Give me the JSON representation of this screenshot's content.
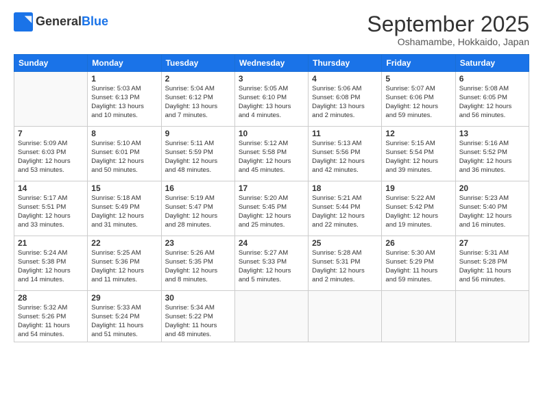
{
  "logo": {
    "general": "General",
    "blue": "Blue"
  },
  "header": {
    "month": "September 2025",
    "location": "Oshamambe, Hokkaido, Japan"
  },
  "weekdays": [
    "Sunday",
    "Monday",
    "Tuesday",
    "Wednesday",
    "Thursday",
    "Friday",
    "Saturday"
  ],
  "weeks": [
    [
      {
        "day": "",
        "detail": ""
      },
      {
        "day": "1",
        "detail": "Sunrise: 5:03 AM\nSunset: 6:13 PM\nDaylight: 13 hours\nand 10 minutes."
      },
      {
        "day": "2",
        "detail": "Sunrise: 5:04 AM\nSunset: 6:12 PM\nDaylight: 13 hours\nand 7 minutes."
      },
      {
        "day": "3",
        "detail": "Sunrise: 5:05 AM\nSunset: 6:10 PM\nDaylight: 13 hours\nand 4 minutes."
      },
      {
        "day": "4",
        "detail": "Sunrise: 5:06 AM\nSunset: 6:08 PM\nDaylight: 13 hours\nand 2 minutes."
      },
      {
        "day": "5",
        "detail": "Sunrise: 5:07 AM\nSunset: 6:06 PM\nDaylight: 12 hours\nand 59 minutes."
      },
      {
        "day": "6",
        "detail": "Sunrise: 5:08 AM\nSunset: 6:05 PM\nDaylight: 12 hours\nand 56 minutes."
      }
    ],
    [
      {
        "day": "7",
        "detail": "Sunrise: 5:09 AM\nSunset: 6:03 PM\nDaylight: 12 hours\nand 53 minutes."
      },
      {
        "day": "8",
        "detail": "Sunrise: 5:10 AM\nSunset: 6:01 PM\nDaylight: 12 hours\nand 50 minutes."
      },
      {
        "day": "9",
        "detail": "Sunrise: 5:11 AM\nSunset: 5:59 PM\nDaylight: 12 hours\nand 48 minutes."
      },
      {
        "day": "10",
        "detail": "Sunrise: 5:12 AM\nSunset: 5:58 PM\nDaylight: 12 hours\nand 45 minutes."
      },
      {
        "day": "11",
        "detail": "Sunrise: 5:13 AM\nSunset: 5:56 PM\nDaylight: 12 hours\nand 42 minutes."
      },
      {
        "day": "12",
        "detail": "Sunrise: 5:15 AM\nSunset: 5:54 PM\nDaylight: 12 hours\nand 39 minutes."
      },
      {
        "day": "13",
        "detail": "Sunrise: 5:16 AM\nSunset: 5:52 PM\nDaylight: 12 hours\nand 36 minutes."
      }
    ],
    [
      {
        "day": "14",
        "detail": "Sunrise: 5:17 AM\nSunset: 5:51 PM\nDaylight: 12 hours\nand 33 minutes."
      },
      {
        "day": "15",
        "detail": "Sunrise: 5:18 AM\nSunset: 5:49 PM\nDaylight: 12 hours\nand 31 minutes."
      },
      {
        "day": "16",
        "detail": "Sunrise: 5:19 AM\nSunset: 5:47 PM\nDaylight: 12 hours\nand 28 minutes."
      },
      {
        "day": "17",
        "detail": "Sunrise: 5:20 AM\nSunset: 5:45 PM\nDaylight: 12 hours\nand 25 minutes."
      },
      {
        "day": "18",
        "detail": "Sunrise: 5:21 AM\nSunset: 5:44 PM\nDaylight: 12 hours\nand 22 minutes."
      },
      {
        "day": "19",
        "detail": "Sunrise: 5:22 AM\nSunset: 5:42 PM\nDaylight: 12 hours\nand 19 minutes."
      },
      {
        "day": "20",
        "detail": "Sunrise: 5:23 AM\nSunset: 5:40 PM\nDaylight: 12 hours\nand 16 minutes."
      }
    ],
    [
      {
        "day": "21",
        "detail": "Sunrise: 5:24 AM\nSunset: 5:38 PM\nDaylight: 12 hours\nand 14 minutes."
      },
      {
        "day": "22",
        "detail": "Sunrise: 5:25 AM\nSunset: 5:36 PM\nDaylight: 12 hours\nand 11 minutes."
      },
      {
        "day": "23",
        "detail": "Sunrise: 5:26 AM\nSunset: 5:35 PM\nDaylight: 12 hours\nand 8 minutes."
      },
      {
        "day": "24",
        "detail": "Sunrise: 5:27 AM\nSunset: 5:33 PM\nDaylight: 12 hours\nand 5 minutes."
      },
      {
        "day": "25",
        "detail": "Sunrise: 5:28 AM\nSunset: 5:31 PM\nDaylight: 12 hours\nand 2 minutes."
      },
      {
        "day": "26",
        "detail": "Sunrise: 5:30 AM\nSunset: 5:29 PM\nDaylight: 11 hours\nand 59 minutes."
      },
      {
        "day": "27",
        "detail": "Sunrise: 5:31 AM\nSunset: 5:28 PM\nDaylight: 11 hours\nand 56 minutes."
      }
    ],
    [
      {
        "day": "28",
        "detail": "Sunrise: 5:32 AM\nSunset: 5:26 PM\nDaylight: 11 hours\nand 54 minutes."
      },
      {
        "day": "29",
        "detail": "Sunrise: 5:33 AM\nSunset: 5:24 PM\nDaylight: 11 hours\nand 51 minutes."
      },
      {
        "day": "30",
        "detail": "Sunrise: 5:34 AM\nSunset: 5:22 PM\nDaylight: 11 hours\nand 48 minutes."
      },
      {
        "day": "",
        "detail": ""
      },
      {
        "day": "",
        "detail": ""
      },
      {
        "day": "",
        "detail": ""
      },
      {
        "day": "",
        "detail": ""
      }
    ]
  ]
}
